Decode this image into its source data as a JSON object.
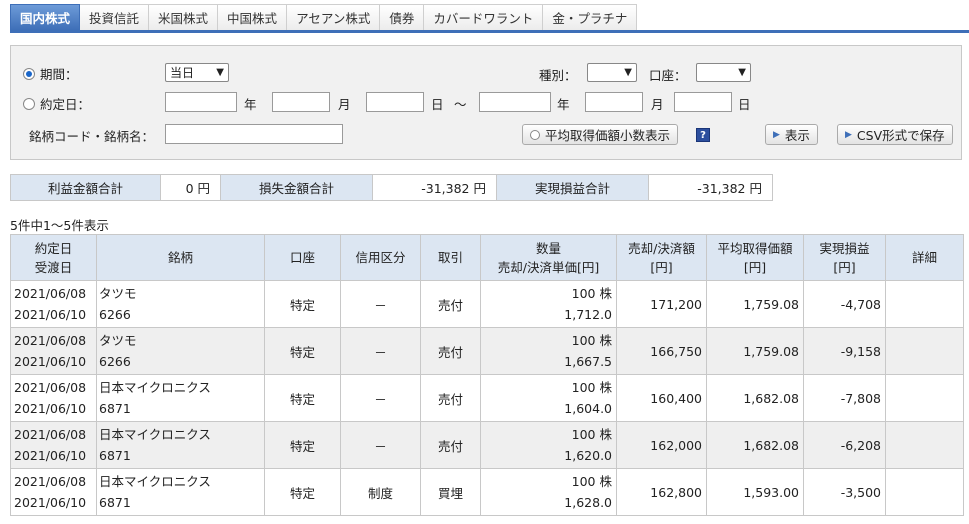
{
  "tabs": [
    "国内株式",
    "投資信託",
    "米国株式",
    "中国株式",
    "アセアン株式",
    "債券",
    "カバードワラント",
    "金・プラチナ"
  ],
  "search": {
    "period_label": "期間：",
    "period_value": "当日",
    "contract_date_label": "約定日：",
    "year": "年",
    "month": "月",
    "day": "日",
    "tilde": "～",
    "type_label": "種別：",
    "account_label": "口座：",
    "code_label": "銘柄コード・銘柄名：",
    "avg_button": "平均取得価額小数表示",
    "help": "?",
    "show_button": "表示",
    "csv_button": "CSV形式で保存"
  },
  "summary": {
    "profit_label": "利益金額合計",
    "profit_value": "0 円",
    "loss_label": "損失金額合計",
    "loss_value": "-31,382 円",
    "realized_label": "実現損益合計",
    "realized_value": "-31,382 円"
  },
  "count_text": "5件中1～5件表示",
  "columns": {
    "date1": "約定日",
    "date2": "受渡日",
    "name": "銘柄",
    "account": "口座",
    "margin": "信用区分",
    "trade": "取引",
    "qty1": "数量",
    "qty2": "売却/決済単価[円]",
    "amount1": "売却/決済額",
    "amount2": "[円]",
    "avg1": "平均取得価額",
    "avg2": "[円]",
    "pl1": "実現損益",
    "pl2": "[円]",
    "detail": "詳細"
  },
  "rows": [
    {
      "contract": "2021/06/08",
      "delivery": "2021/06/10",
      "name": "タツモ",
      "code": "6266",
      "account": "特定",
      "margin": "－",
      "trade": "売付",
      "qty": "100 株",
      "price": "1,712.0",
      "amount": "171,200",
      "avg": "1,759.08",
      "pl": "-4,708"
    },
    {
      "contract": "2021/06/08",
      "delivery": "2021/06/10",
      "name": "タツモ",
      "code": "6266",
      "account": "特定",
      "margin": "－",
      "trade": "売付",
      "qty": "100 株",
      "price": "1,667.5",
      "amount": "166,750",
      "avg": "1,759.08",
      "pl": "-9,158"
    },
    {
      "contract": "2021/06/08",
      "delivery": "2021/06/10",
      "name": "日本マイクロニクス",
      "code": "6871",
      "account": "特定",
      "margin": "－",
      "trade": "売付",
      "qty": "100 株",
      "price": "1,604.0",
      "amount": "160,400",
      "avg": "1,682.08",
      "pl": "-7,808"
    },
    {
      "contract": "2021/06/08",
      "delivery": "2021/06/10",
      "name": "日本マイクロニクス",
      "code": "6871",
      "account": "特定",
      "margin": "－",
      "trade": "売付",
      "qty": "100 株",
      "price": "1,620.0",
      "amount": "162,000",
      "avg": "1,682.08",
      "pl": "-6,208"
    },
    {
      "contract": "2021/06/08",
      "delivery": "2021/06/10",
      "name": "日本マイクロニクス",
      "code": "6871",
      "account": "特定",
      "margin": "制度",
      "trade": "買埋",
      "qty": "100 株",
      "price": "1,628.0",
      "amount": "162,800",
      "avg": "1,593.00",
      "pl": "-3,500"
    }
  ]
}
